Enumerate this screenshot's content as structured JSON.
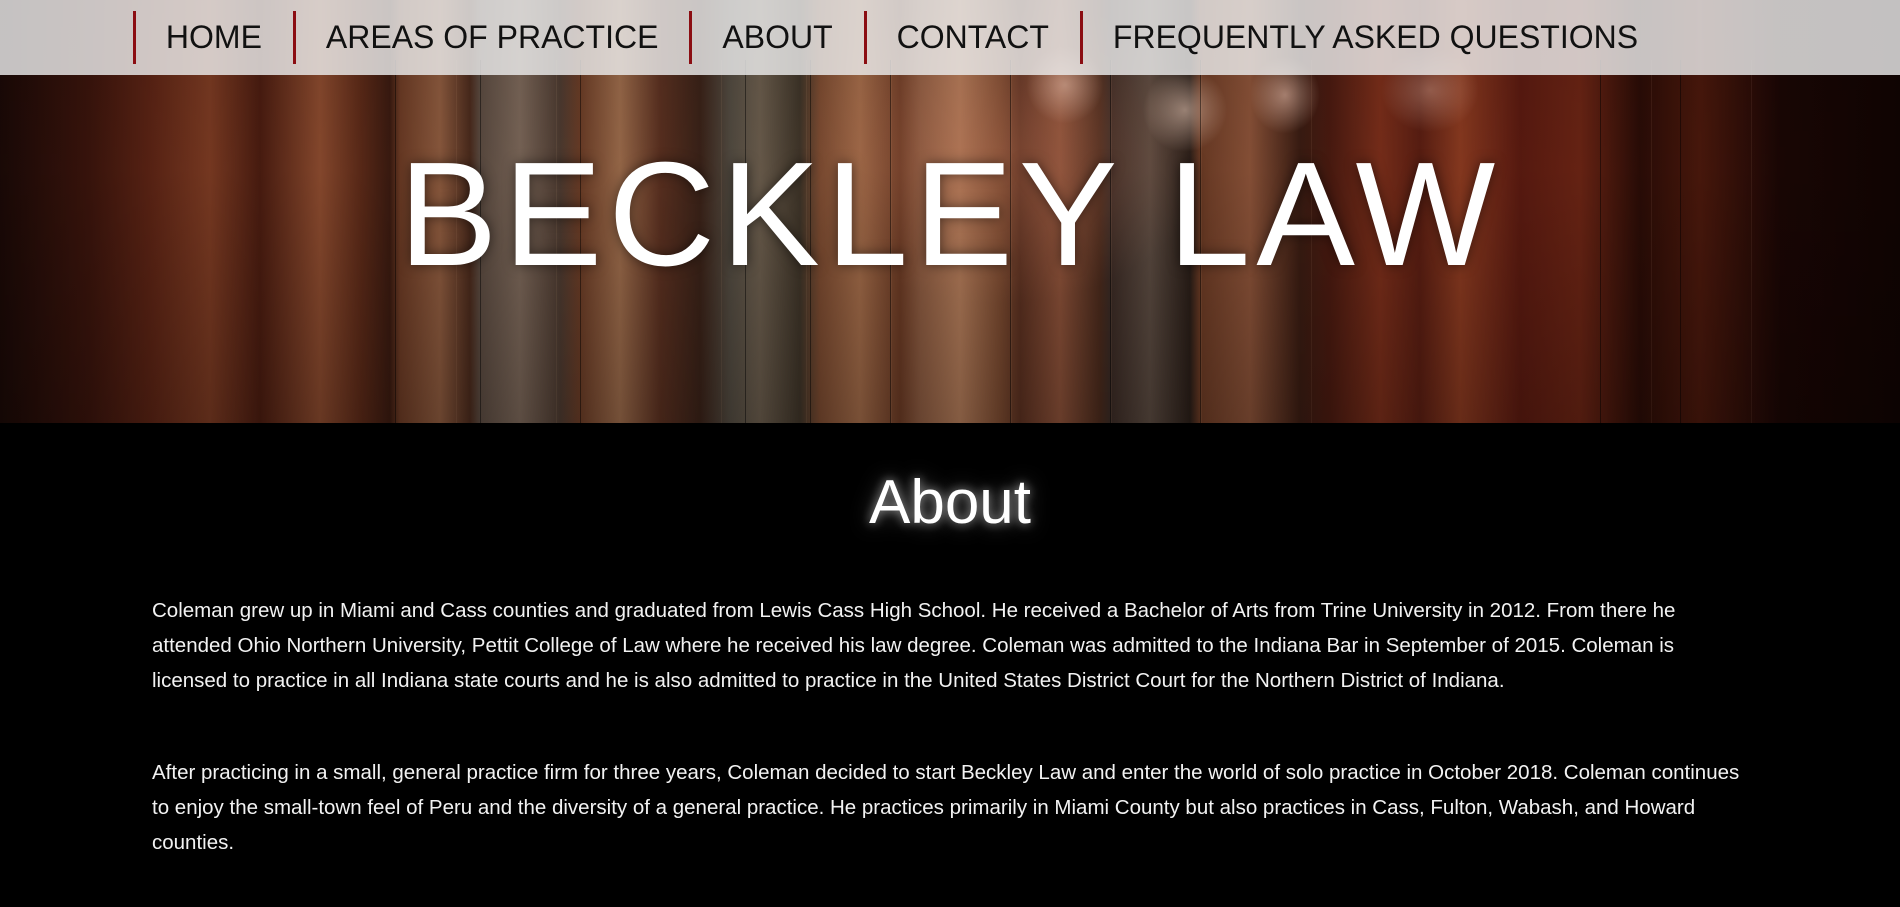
{
  "nav": {
    "items": [
      {
        "label": "HOME"
      },
      {
        "label": "AREAS OF PRACTICE"
      },
      {
        "label": "ABOUT"
      },
      {
        "label": "CONTACT"
      },
      {
        "label": "FREQUENTLY ASKED QUESTIONS"
      }
    ],
    "divider_color": "#8b0d12"
  },
  "hero": {
    "brand": "BECKLEY LAW"
  },
  "about": {
    "title": "About",
    "paragraphs": [
      "Coleman grew up in Miami and Cass counties and graduated from Lewis Cass High School. He received a Bachelor of Arts from Trine University in 2012. From there he attended Ohio Northern University, Pettit College of Law where he received his law degree. Coleman was admitted to the Indiana Bar in September of 2015. Coleman is licensed to practice in all Indiana state courts and he is also admitted to practice in the United States District Court for the Northern District of Indiana.",
      "After practicing in a small, general practice firm for three years, Coleman decided to start Beckley Law and enter the world of solo practice in October 2018. Coleman continues to enjoy the small-town feel of Peru and the diversity of a general practice. He practices primarily in Miami County but also practices in Cass, Fulton, Wabash, and Howard counties."
    ]
  }
}
